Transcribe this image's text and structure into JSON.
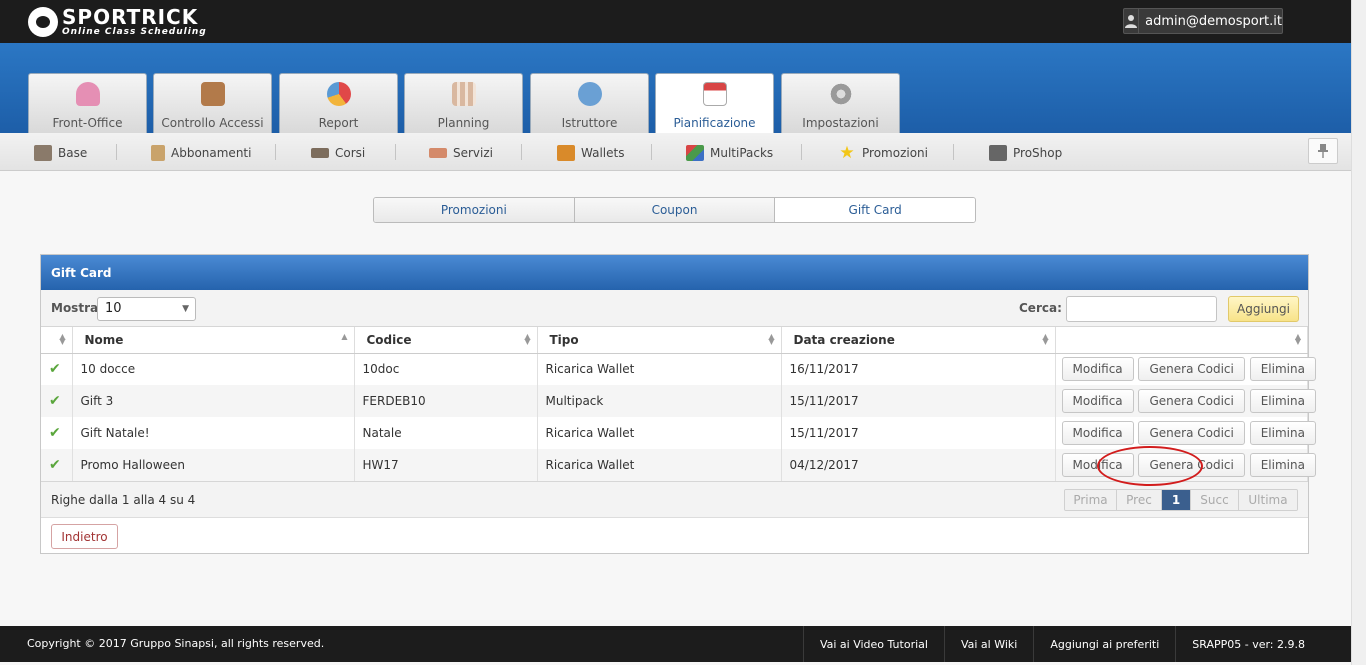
{
  "app": {
    "brand": "SPORTRICK",
    "tagline": "Online Class Scheduling",
    "user": "admin@demosport.it"
  },
  "main_tabs": [
    {
      "label": "Front-Office",
      "icon": "person-icon",
      "color": "#e58fb4"
    },
    {
      "label": "Controllo Accessi",
      "icon": "door-icon",
      "color": "#b27a4a"
    },
    {
      "label": "Report",
      "icon": "pie-chart-icon",
      "color": "#e04848"
    },
    {
      "label": "Planning",
      "icon": "calendar-grid-icon",
      "color": "#d9b8a0"
    },
    {
      "label": "Istruttore",
      "icon": "instructors-icon",
      "color": "#6aa0d4"
    },
    {
      "label": "Pianificazione",
      "icon": "calendar-icon",
      "color": "#d84545",
      "active": true
    },
    {
      "label": "Impostazioni",
      "icon": "gear-icon",
      "color": "#9a9a9a"
    }
  ],
  "sub_nav": [
    {
      "label": "Base",
      "icon": "building-icon",
      "color": "#8a7a6a"
    },
    {
      "label": "Abbonamenti",
      "icon": "clipboard-icon",
      "color": "#c9a36b"
    },
    {
      "label": "Corsi",
      "icon": "shoe-icon",
      "color": "#7d6d5d"
    },
    {
      "label": "Servizi",
      "icon": "handshake-icon",
      "color": "#d48a6a"
    },
    {
      "label": "Wallets",
      "icon": "wallet-icon",
      "color": "#d98a2a"
    },
    {
      "label": "MultiPacks",
      "icon": "cubes-icon",
      "color": "#4a9a4a"
    },
    {
      "label": "Promozioni",
      "icon": "star-icon",
      "color": "#f2c618"
    },
    {
      "label": "ProShop",
      "icon": "register-icon",
      "color": "#666666"
    }
  ],
  "segments": [
    {
      "label": "Promozioni",
      "active": false
    },
    {
      "label": "Coupon",
      "active": false
    },
    {
      "label": "Gift Card",
      "active": true
    }
  ],
  "panel": {
    "title": "Gift Card",
    "show_label": "Mostra",
    "show_value": "10",
    "search_label": "Cerca:",
    "search_value": "",
    "add_label": "Aggiungi"
  },
  "table": {
    "columns": [
      "",
      "Nome",
      "Codice",
      "Tipo",
      "Data creazione",
      ""
    ],
    "rows": [
      {
        "nome": "10 docce",
        "codice": "10doc",
        "tipo": "Ricarica Wallet",
        "data": "16/11/2017"
      },
      {
        "nome": "Gift 3",
        "codice": "FERDEB10",
        "tipo": "Multipack",
        "data": "15/11/2017"
      },
      {
        "nome": "Gift Natale!",
        "codice": "Natale",
        "tipo": "Ricarica Wallet",
        "data": "15/11/2017"
      },
      {
        "nome": "Promo Halloween",
        "codice": "HW17",
        "tipo": "Ricarica Wallet",
        "data": "04/12/2017"
      }
    ],
    "actions": {
      "edit": "Modifica",
      "generate": "Genera Codici",
      "delete": "Elimina"
    },
    "info": "Righe dalla 1 alla 4 su 4",
    "pager": {
      "first": "Prima",
      "prev": "Prec",
      "current": "1",
      "next": "Succ",
      "last": "Ultima"
    }
  },
  "back_label": "Indietro",
  "footer": {
    "copyright": "Copyright © 2017 Gruppo Sinapsi, all rights reserved.",
    "links": [
      "Vai ai Video Tutorial",
      "Vai al Wiki",
      "Aggiungi ai preferiti",
      "SRAPP05 - ver: 2.9.8"
    ]
  }
}
